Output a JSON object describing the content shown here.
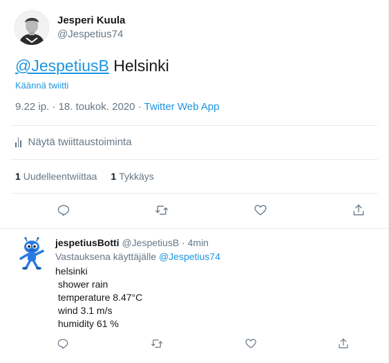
{
  "tweet": {
    "author_name": "Jesperi Kuula",
    "author_handle": "@Jespetius74",
    "mention": "@JespetiusB",
    "text": " Helsinki",
    "translate_label": "Käännä twiitti",
    "time": "9.22 ip.",
    "separator": " · ",
    "date": "18. toukok. 2020",
    "source": "Twitter Web App",
    "activity_label": "Näytä twiittaustoiminta",
    "retweets_count": "1",
    "retweets_label": "Uudelleentwiittaa",
    "likes_count": "1",
    "likes_label": "Tykkäys"
  },
  "reply": {
    "name": "jespetiusBotti",
    "handle": "@JespetiusB",
    "separator": " · ",
    "age": "4min",
    "replying_prefix": "Vastauksena käyttäjälle ",
    "replying_to": "@Jespetius74",
    "body": "helsinki\n shower rain\n temperature 8.47°C\n wind 3.1 m/s\n humidity 61 %"
  },
  "icons": {
    "reply": "reply-icon",
    "retweet": "retweet-icon",
    "like": "heart-icon",
    "share": "share-icon",
    "activity": "bar-chart-icon"
  },
  "colors": {
    "link": "#1b95e0",
    "secondary_text": "#657786",
    "primary_text": "#14171a",
    "divider": "#e6ecf0"
  }
}
